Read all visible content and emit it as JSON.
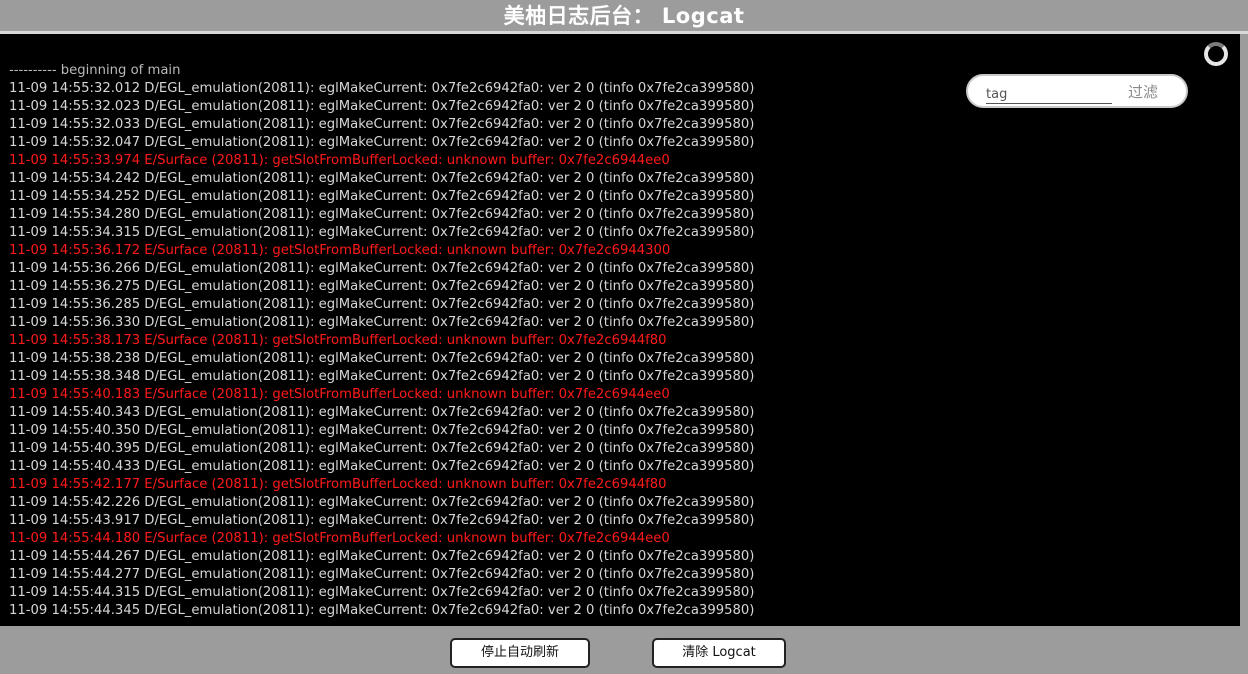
{
  "header": {
    "title": "美柚日志后台： Logcat"
  },
  "filter": {
    "tag_placeholder": "tag",
    "filter_label": "过滤"
  },
  "logs": [
    {
      "text": "---------- beginning of main",
      "level": "start"
    },
    {
      "text": "11-09 14:55:32.012 D/EGL_emulation(20811): eglMakeCurrent: 0x7fe2c6942fa0: ver 2 0 (tinfo 0x7fe2ca399580)",
      "level": "debug"
    },
    {
      "text": "11-09 14:55:32.023 D/EGL_emulation(20811): eglMakeCurrent: 0x7fe2c6942fa0: ver 2 0 (tinfo 0x7fe2ca399580)",
      "level": "debug"
    },
    {
      "text": "11-09 14:55:32.033 D/EGL_emulation(20811): eglMakeCurrent: 0x7fe2c6942fa0: ver 2 0 (tinfo 0x7fe2ca399580)",
      "level": "debug"
    },
    {
      "text": "11-09 14:55:32.047 D/EGL_emulation(20811): eglMakeCurrent: 0x7fe2c6942fa0: ver 2 0 (tinfo 0x7fe2ca399580)",
      "level": "debug"
    },
    {
      "text": "11-09 14:55:33.974 E/Surface (20811): getSlotFromBufferLocked: unknown buffer: 0x7fe2c6944ee0",
      "level": "error"
    },
    {
      "text": "11-09 14:55:34.242 D/EGL_emulation(20811): eglMakeCurrent: 0x7fe2c6942fa0: ver 2 0 (tinfo 0x7fe2ca399580)",
      "level": "debug"
    },
    {
      "text": "11-09 14:55:34.252 D/EGL_emulation(20811): eglMakeCurrent: 0x7fe2c6942fa0: ver 2 0 (tinfo 0x7fe2ca399580)",
      "level": "debug"
    },
    {
      "text": "11-09 14:55:34.280 D/EGL_emulation(20811): eglMakeCurrent: 0x7fe2c6942fa0: ver 2 0 (tinfo 0x7fe2ca399580)",
      "level": "debug"
    },
    {
      "text": "11-09 14:55:34.315 D/EGL_emulation(20811): eglMakeCurrent: 0x7fe2c6942fa0: ver 2 0 (tinfo 0x7fe2ca399580)",
      "level": "debug"
    },
    {
      "text": "11-09 14:55:36.172 E/Surface (20811): getSlotFromBufferLocked: unknown buffer: 0x7fe2c6944300",
      "level": "error"
    },
    {
      "text": "11-09 14:55:36.266 D/EGL_emulation(20811): eglMakeCurrent: 0x7fe2c6942fa0: ver 2 0 (tinfo 0x7fe2ca399580)",
      "level": "debug"
    },
    {
      "text": "11-09 14:55:36.275 D/EGL_emulation(20811): eglMakeCurrent: 0x7fe2c6942fa0: ver 2 0 (tinfo 0x7fe2ca399580)",
      "level": "debug"
    },
    {
      "text": "11-09 14:55:36.285 D/EGL_emulation(20811): eglMakeCurrent: 0x7fe2c6942fa0: ver 2 0 (tinfo 0x7fe2ca399580)",
      "level": "debug"
    },
    {
      "text": "11-09 14:55:36.330 D/EGL_emulation(20811): eglMakeCurrent: 0x7fe2c6942fa0: ver 2 0 (tinfo 0x7fe2ca399580)",
      "level": "debug"
    },
    {
      "text": "11-09 14:55:38.173 E/Surface (20811): getSlotFromBufferLocked: unknown buffer: 0x7fe2c6944f80",
      "level": "error"
    },
    {
      "text": "11-09 14:55:38.238 D/EGL_emulation(20811): eglMakeCurrent: 0x7fe2c6942fa0: ver 2 0 (tinfo 0x7fe2ca399580)",
      "level": "debug"
    },
    {
      "text": "11-09 14:55:38.348 D/EGL_emulation(20811): eglMakeCurrent: 0x7fe2c6942fa0: ver 2 0 (tinfo 0x7fe2ca399580)",
      "level": "debug"
    },
    {
      "text": "11-09 14:55:40.183 E/Surface (20811): getSlotFromBufferLocked: unknown buffer: 0x7fe2c6944ee0",
      "level": "error"
    },
    {
      "text": "11-09 14:55:40.343 D/EGL_emulation(20811): eglMakeCurrent: 0x7fe2c6942fa0: ver 2 0 (tinfo 0x7fe2ca399580)",
      "level": "debug"
    },
    {
      "text": "11-09 14:55:40.350 D/EGL_emulation(20811): eglMakeCurrent: 0x7fe2c6942fa0: ver 2 0 (tinfo 0x7fe2ca399580)",
      "level": "debug"
    },
    {
      "text": "11-09 14:55:40.395 D/EGL_emulation(20811): eglMakeCurrent: 0x7fe2c6942fa0: ver 2 0 (tinfo 0x7fe2ca399580)",
      "level": "debug"
    },
    {
      "text": "11-09 14:55:40.433 D/EGL_emulation(20811): eglMakeCurrent: 0x7fe2c6942fa0: ver 2 0 (tinfo 0x7fe2ca399580)",
      "level": "debug"
    },
    {
      "text": "11-09 14:55:42.177 E/Surface (20811): getSlotFromBufferLocked: unknown buffer: 0x7fe2c6944f80",
      "level": "error"
    },
    {
      "text": "11-09 14:55:42.226 D/EGL_emulation(20811): eglMakeCurrent: 0x7fe2c6942fa0: ver 2 0 (tinfo 0x7fe2ca399580)",
      "level": "debug"
    },
    {
      "text": "11-09 14:55:43.917 D/EGL_emulation(20811): eglMakeCurrent: 0x7fe2c6942fa0: ver 2 0 (tinfo 0x7fe2ca399580)",
      "level": "debug"
    },
    {
      "text": "11-09 14:55:44.180 E/Surface (20811): getSlotFromBufferLocked: unknown buffer: 0x7fe2c6944ee0",
      "level": "error"
    },
    {
      "text": "11-09 14:55:44.267 D/EGL_emulation(20811): eglMakeCurrent: 0x7fe2c6942fa0: ver 2 0 (tinfo 0x7fe2ca399580)",
      "level": "debug"
    },
    {
      "text": "11-09 14:55:44.277 D/EGL_emulation(20811): eglMakeCurrent: 0x7fe2c6942fa0: ver 2 0 (tinfo 0x7fe2ca399580)",
      "level": "debug"
    },
    {
      "text": "11-09 14:55:44.315 D/EGL_emulation(20811): eglMakeCurrent: 0x7fe2c6942fa0: ver 2 0 (tinfo 0x7fe2ca399580)",
      "level": "debug"
    },
    {
      "text": "11-09 14:55:44.345 D/EGL_emulation(20811): eglMakeCurrent: 0x7fe2c6942fa0: ver 2 0 (tinfo 0x7fe2ca399580)",
      "level": "debug"
    }
  ],
  "buttons": {
    "stop_refresh": "停止自动刷新",
    "clear_logcat": "清除 Logcat"
  },
  "colors": {
    "background": "#9c9c9c",
    "console": "#000000",
    "log_text": "#d6d6d6",
    "error_text": "#ff1a1a"
  }
}
